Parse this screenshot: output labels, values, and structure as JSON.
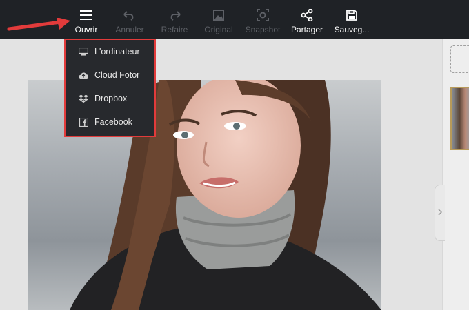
{
  "toolbar": {
    "items": [
      {
        "label": "Ouvrir",
        "icon": "menu-icon",
        "enabled": true
      },
      {
        "label": "Annuler",
        "icon": "undo-icon",
        "enabled": false
      },
      {
        "label": "Refaire",
        "icon": "redo-icon",
        "enabled": false
      },
      {
        "label": "Original",
        "icon": "image-icon",
        "enabled": false
      },
      {
        "label": "Snapshot",
        "icon": "snapshot-icon",
        "enabled": false
      },
      {
        "label": "Partager",
        "icon": "share-icon",
        "enabled": true
      },
      {
        "label": "Sauveg...",
        "icon": "save-icon",
        "enabled": true
      }
    ]
  },
  "open_menu": {
    "items": [
      {
        "label": "L'ordinateur",
        "icon": "monitor-icon"
      },
      {
        "label": "Cloud Fotor",
        "icon": "cloud-upload-icon"
      },
      {
        "label": "Dropbox",
        "icon": "dropbox-icon"
      },
      {
        "label": "Facebook",
        "icon": "facebook-icon"
      }
    ]
  },
  "colors": {
    "toolbar_bg": "#1f2226",
    "menu_bg": "#27292d",
    "highlight_red": "#e23b3b",
    "canvas_bg": "#e3e3e3"
  },
  "canvas": {
    "photo_subject": "portrait-photo"
  }
}
